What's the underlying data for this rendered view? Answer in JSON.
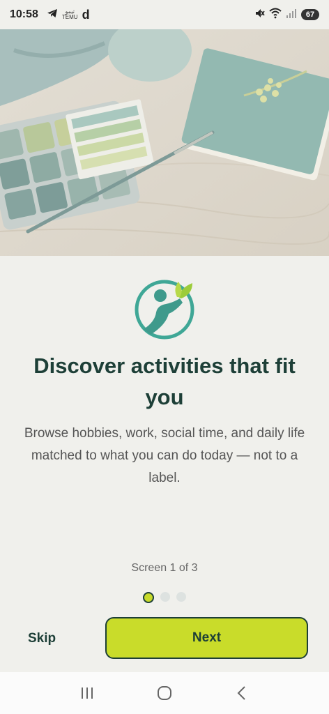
{
  "status_bar": {
    "time": "10:58",
    "notif_icons": [
      "telegram-icon",
      "temu-icon",
      "d-icon"
    ],
    "temu_line1": "ﺗﻴﻤﻮ",
    "temu_line2": "TEMU",
    "d_glyph": "d",
    "battery": "67"
  },
  "onboarding": {
    "title": "Discover activities that fit you",
    "description": "Browse hobbies, work, social time, and daily life matched to what you can do today — not to a label.",
    "progress": "Screen 1 of 3",
    "current_page": 1,
    "total_pages": 3,
    "skip_label": "Skip",
    "next_label": "Next"
  },
  "colors": {
    "brand_dark": "#1d3f37",
    "accent_lime": "#c9dc2a",
    "teal": "#3f9a8c",
    "background": "#f0f0ec"
  },
  "nav": {
    "items": [
      "recent-apps-icon",
      "home-icon",
      "back-icon"
    ]
  }
}
